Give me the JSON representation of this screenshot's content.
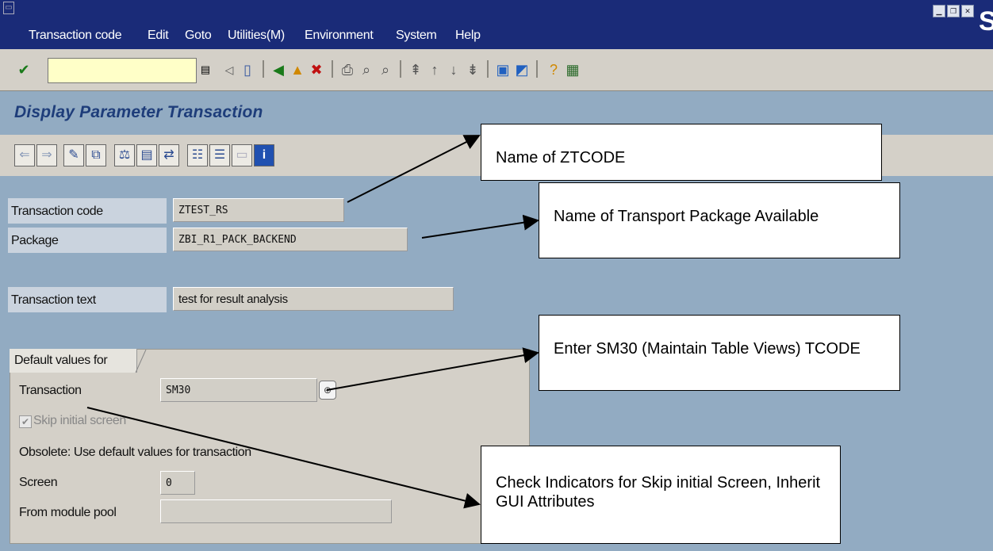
{
  "menubar": {
    "items": [
      "Transaction code",
      "Edit",
      "Goto",
      "Utilities(M)",
      "Environment",
      "System",
      "Help"
    ],
    "brand": "S"
  },
  "window_controls": [
    "minimize-icon",
    "restore-icon",
    "close-icon"
  ],
  "std_toolbar": {
    "command_field_value": "",
    "icons": [
      "enter-icon",
      "command-dropdown-icon",
      "back-arrow-icon",
      "save-icon",
      "back-icon",
      "exit-icon",
      "cancel-icon",
      "print-icon",
      "find-icon",
      "find-next-icon",
      "first-page-icon",
      "previous-page-icon",
      "next-page-icon",
      "last-page-icon",
      "create-session-icon",
      "shortcut-icon",
      "help-icon",
      "customize-layout-icon"
    ]
  },
  "page_title": "Display Parameter Transaction",
  "app_toolbar": {
    "icons": [
      "back-nav-icon",
      "forward-nav-icon",
      "display-change-icon",
      "other-object-icon",
      "check-icon",
      "activate-icon",
      "where-used-icon",
      "object-list-icon",
      "hierarchy-icon",
      "text-icon",
      "info-icon"
    ]
  },
  "form": {
    "transaction_code_label": "Transaction code",
    "transaction_code_value": "ZTEST_RS",
    "package_label": "Package",
    "package_value": "ZBI_R1_PACK_BACKEND",
    "transaction_text_label": "Transaction text",
    "transaction_text_value": "test for  result analysis"
  },
  "default_values": {
    "group_title": "Default values for",
    "transaction_label": "Transaction",
    "transaction_value": "SM30",
    "skip_initial_label": "Skip initial screen",
    "skip_initial_checked": true,
    "obsolete_label": "Obsolete: Use default values for transaction",
    "screen_label": "Screen",
    "screen_value": "0",
    "module_pool_label": "From module pool",
    "module_pool_value": ""
  },
  "callouts": {
    "ztcode": "Name of ZTCODE",
    "package": "Name of Transport Package Available",
    "sm30": "Enter SM30 (Maintain Table Views) TCODE",
    "check": "Check Indicators for Skip initial Screen, Inherit GUI Attributes"
  },
  "colors": {
    "menubar_bg": "#1a2b78",
    "page_bg": "#92abc2",
    "toolbar_bg": "#d4d0c8",
    "title_color": "#1e3d7a"
  }
}
